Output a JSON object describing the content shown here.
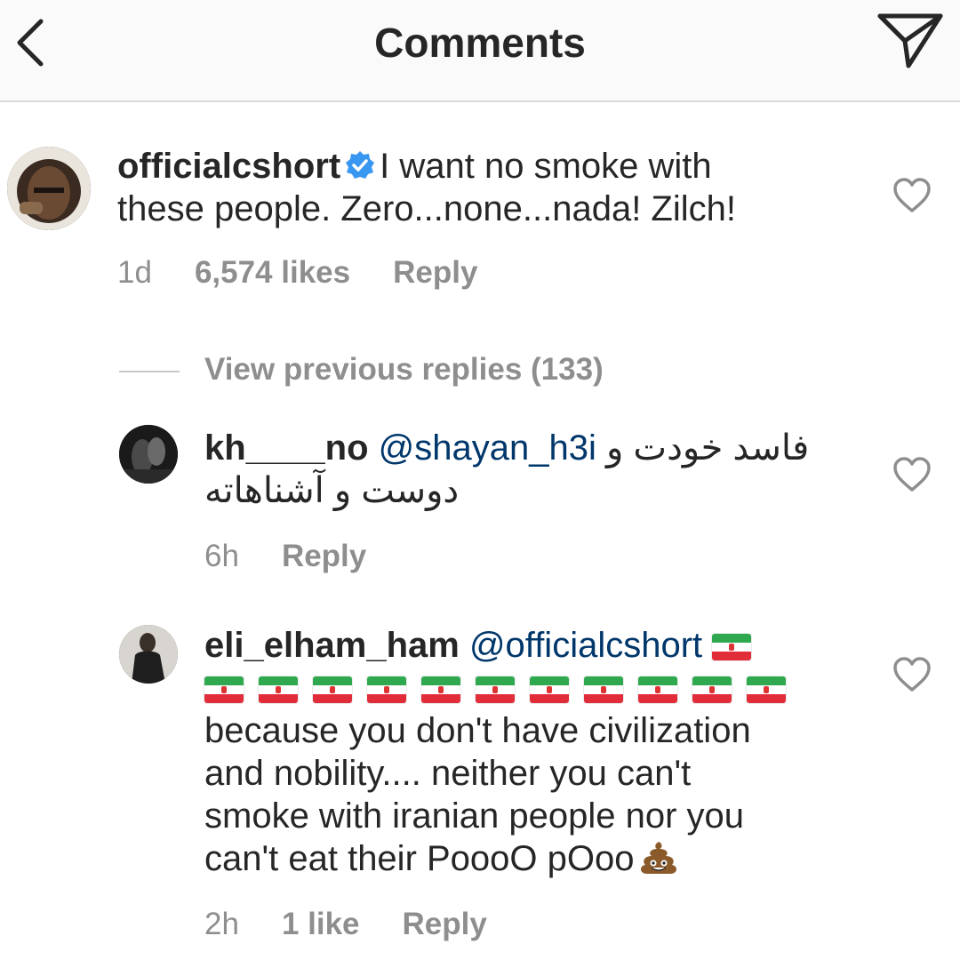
{
  "header": {
    "title": "Comments",
    "back_icon": "chevron-left-icon",
    "share_icon": "paper-plane-icon"
  },
  "colors": {
    "text": "#262626",
    "muted": "#8e8e8e",
    "mention": "#00376b",
    "verified": "#3897f0",
    "header_bg": "#fafafa"
  },
  "comments": [
    {
      "username": "officialcshort",
      "verified": true,
      "text_line1": "I want no smoke with",
      "text_line2": "these people. Zero...none...nada! Zilch!",
      "time": "1d",
      "likes": "6,574 likes",
      "reply": "Reply"
    }
  ],
  "view_previous": "View previous replies (133)",
  "replies": [
    {
      "username": "kh____no",
      "mention": "@shayan_h3i",
      "text_line1": "فاسد خودت و",
      "text_line2": "دوست و آشناهاته",
      "time": "6h",
      "reply": "Reply"
    },
    {
      "username": "eli_elham_ham",
      "mention": "@officialcshort",
      "flag_emoji": "🇮🇷",
      "flag_count": 12,
      "text_line1": "because you don't have civilization",
      "text_line2": "and nobility.... neither you can't",
      "text_line3": "smoke with iranian people nor you",
      "text_line4": "can't eat their PoooO pOoo",
      "emoji": "💩",
      "time": "2h",
      "likes": "1 like",
      "reply": "Reply"
    }
  ]
}
